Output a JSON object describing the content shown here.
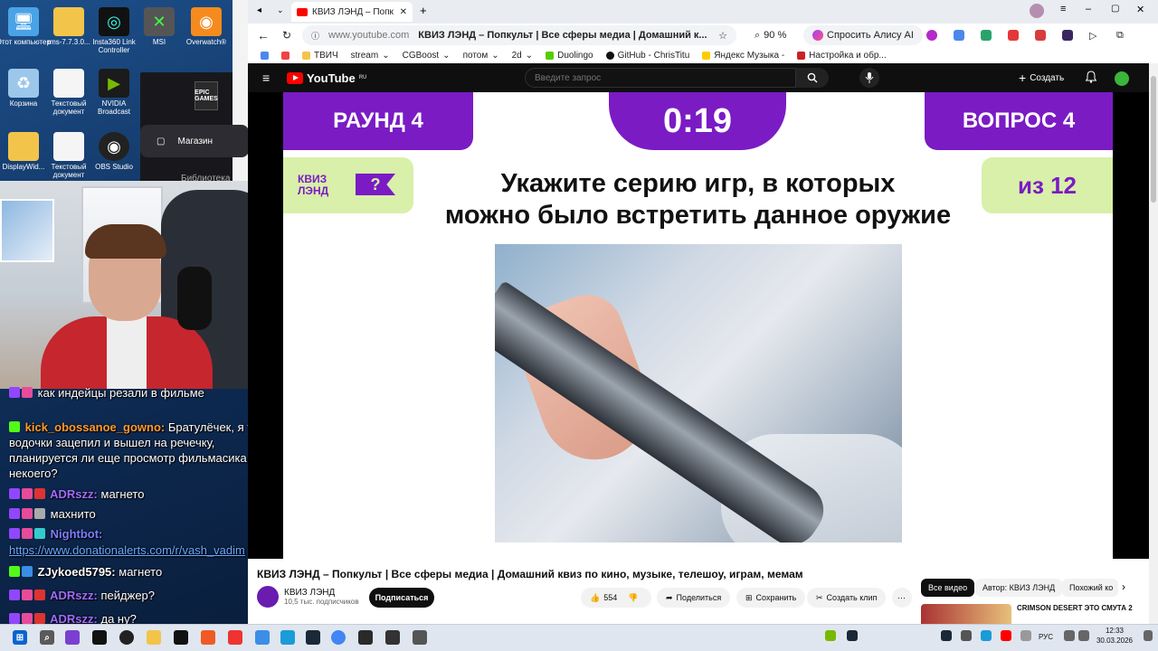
{
  "desktop": {
    "icons": [
      {
        "label": "Этот компьютер",
        "glyph": "🖥"
      },
      {
        "label": "rms-7.7.3.0...",
        "glyph": "📁"
      },
      {
        "label": "Insta360 Link Controller",
        "glyph": "◎"
      },
      {
        "label": "MSI",
        "glyph": "✕"
      },
      {
        "label": "Overwatch®",
        "glyph": "◉"
      },
      {
        "label": "Корзина",
        "glyph": "♻"
      },
      {
        "label": "Текстовый документ",
        "glyph": "📄"
      },
      {
        "label": "NVIDIA Broadcast",
        "glyph": "▶"
      },
      {
        "label": "DisplayWid...",
        "glyph": "📁"
      },
      {
        "label": "Текстовый документ",
        "glyph": "📄"
      },
      {
        "label": "OBS Studio",
        "glyph": "◉"
      }
    ]
  },
  "epic": {
    "logo": "EPIC GAMES",
    "store_label": "Магазин",
    "library_label": "Библиотека"
  },
  "chat": {
    "messages": [
      {
        "user": "",
        "text": "как индейцы резали в фильме",
        "user_color": "#ff4f4f"
      },
      {
        "user": "kick_obossanoe_gowno:",
        "text": "Братулёчек, я тут водочки зацепил и вышел на речечку, планируется ли еще просмотр фильмасика некоего?",
        "user_color": "#ff9a2e"
      },
      {
        "user": "ADRszz:",
        "text": "магнето",
        "user_color": "#a26bff"
      },
      {
        "user": "",
        "text": "махнито",
        "user_color": "#ff3030"
      },
      {
        "user": "Nightbot:",
        "text": "",
        "user_color": "#7d7dff"
      },
      {
        "user": "",
        "text": "https://www.donationalerts.com/r/vash_vadim",
        "user_color": "#6aa7ff"
      },
      {
        "user": "ZJykoed5795:",
        "text": "магнето",
        "user_color": "#ffffff"
      },
      {
        "user": "ADRszz:",
        "text": "пейджер?",
        "user_color": "#a26bff"
      },
      {
        "user": "ADRszz:",
        "text": "да ну?",
        "user_color": "#a26bff"
      }
    ]
  },
  "browser": {
    "tab_title": "КВИЗ ЛЭНД – Попк",
    "address_host": "www.youtube.com",
    "address_title": "КВИЗ ЛЭНД – Попкульт | Все сферы медиа | Домашний к...",
    "zoom": "90 %",
    "alice_label": "Спросить Алису AI",
    "bookmarks": [
      "ТВИЧ",
      "stream",
      "CGBoost",
      "потом",
      "2d",
      "Duolingo",
      "GitHub - ChrisTitu",
      "Яндекс Музыка -",
      "Настройка и обр..."
    ]
  },
  "youtube": {
    "logo_text": "YouTube",
    "region": "RU",
    "search_placeholder": "Введите запрос",
    "create_label": "Создать",
    "video": {
      "round_label": "РАУНД 4",
      "timer": "0:19",
      "question_label": "ВОПРОС 4",
      "brand_line1": "КВИЗ",
      "brand_line2": "ЛЭНД",
      "brand_mark": "?",
      "of_total": "из 12",
      "question_line1": "Укажите серию игр, в которых",
      "question_line2": "можно было встретить данное оружие"
    },
    "title": "КВИЗ ЛЭНД – Попкульт | Все сферы медиа | Домашний квиз по кино, музыке, телешоу, играм, мемам",
    "channel_name": "КВИЗ ЛЭНД",
    "subscribers": "10,5 тыс. подписчиков",
    "subscribe_label": "Подписаться",
    "likes": "554",
    "share_label": "Поделиться",
    "save_label": "Сохранить",
    "clip_label": "Создать клип",
    "chips": [
      "Все видео",
      "Автор: КВИЗ ЛЭНД",
      "Похожий ко"
    ],
    "rec_title": "CRIMSON DESERT ЭТО СМУТА 2"
  },
  "taskbar": {
    "lang": "РУС",
    "time": "12:33",
    "date": "30.03.2026"
  },
  "colors": {
    "purple": "#7a1bc4",
    "green": "#d8f0a9",
    "yt_red": "#ff0000"
  }
}
